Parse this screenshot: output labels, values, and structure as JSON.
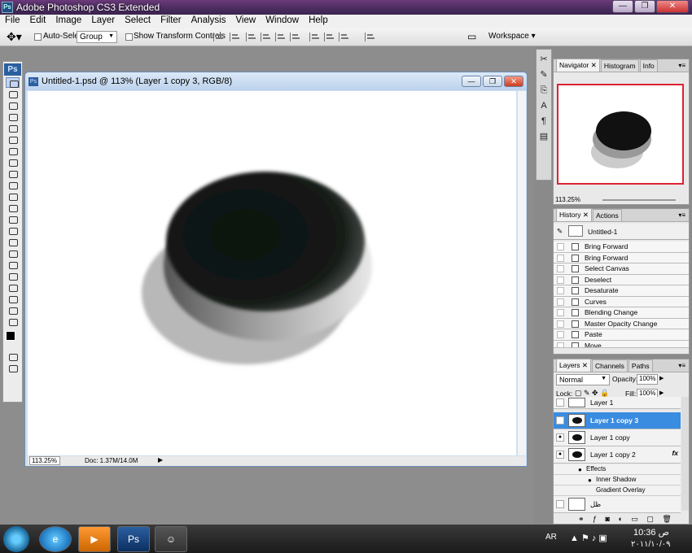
{
  "app": {
    "title": "Adobe Photoshop CS3 Extended",
    "icon_label": "Ps"
  },
  "menu": [
    "File",
    "Edit",
    "Image",
    "Layer",
    "Select",
    "Filter",
    "Analysis",
    "View",
    "Window",
    "Help"
  ],
  "options": {
    "auto_select_label": "Auto-Select:",
    "auto_select_value": "Group",
    "show_transform_label": "Show Transform Controls",
    "workspace_label": "Workspace"
  },
  "document": {
    "title": "Untitled-1.psd @ 113% (Layer 1 copy 3, RGB/8)",
    "zoom": "113.25%",
    "doc_size": "Doc: 1.37M/14.0M"
  },
  "navigator": {
    "tabs": [
      "Navigator",
      "Histogram",
      "Info"
    ],
    "zoom": "113.25%"
  },
  "history": {
    "tabs": [
      "History",
      "Actions"
    ],
    "snapshot": "Untitled-1",
    "items": [
      "Bring Forward",
      "Bring Forward",
      "Select Canvas",
      "Deselect",
      "Desaturate",
      "Curves",
      "Blending Change",
      "Master Opacity Change",
      "Paste",
      "Move"
    ]
  },
  "layers": {
    "tabs": [
      "Layers",
      "Channels",
      "Paths"
    ],
    "blend_mode": "Normal",
    "opacity_label": "Opacity:",
    "opacity": "100%",
    "lock_label": "Lock:",
    "fill_label": "Fill:",
    "fill": "100%",
    "rows": [
      "Layer 1",
      "Layer 1 copy 3",
      "Layer 1 copy",
      "Layer 1 copy 2"
    ],
    "effects_label": "Effects",
    "effect_items": [
      "Inner Shadow",
      "Gradient Overlay"
    ],
    "last_layer": "ظل",
    "fx_label": "fx"
  },
  "taskbar": {
    "lang": "AR",
    "time": "10:36",
    "ampm": "ص",
    "date": "٢٠١١/١٠/٠٩"
  },
  "colors": {
    "selected_layer": "#3a8ce0",
    "nav_frame": "#d22233"
  }
}
